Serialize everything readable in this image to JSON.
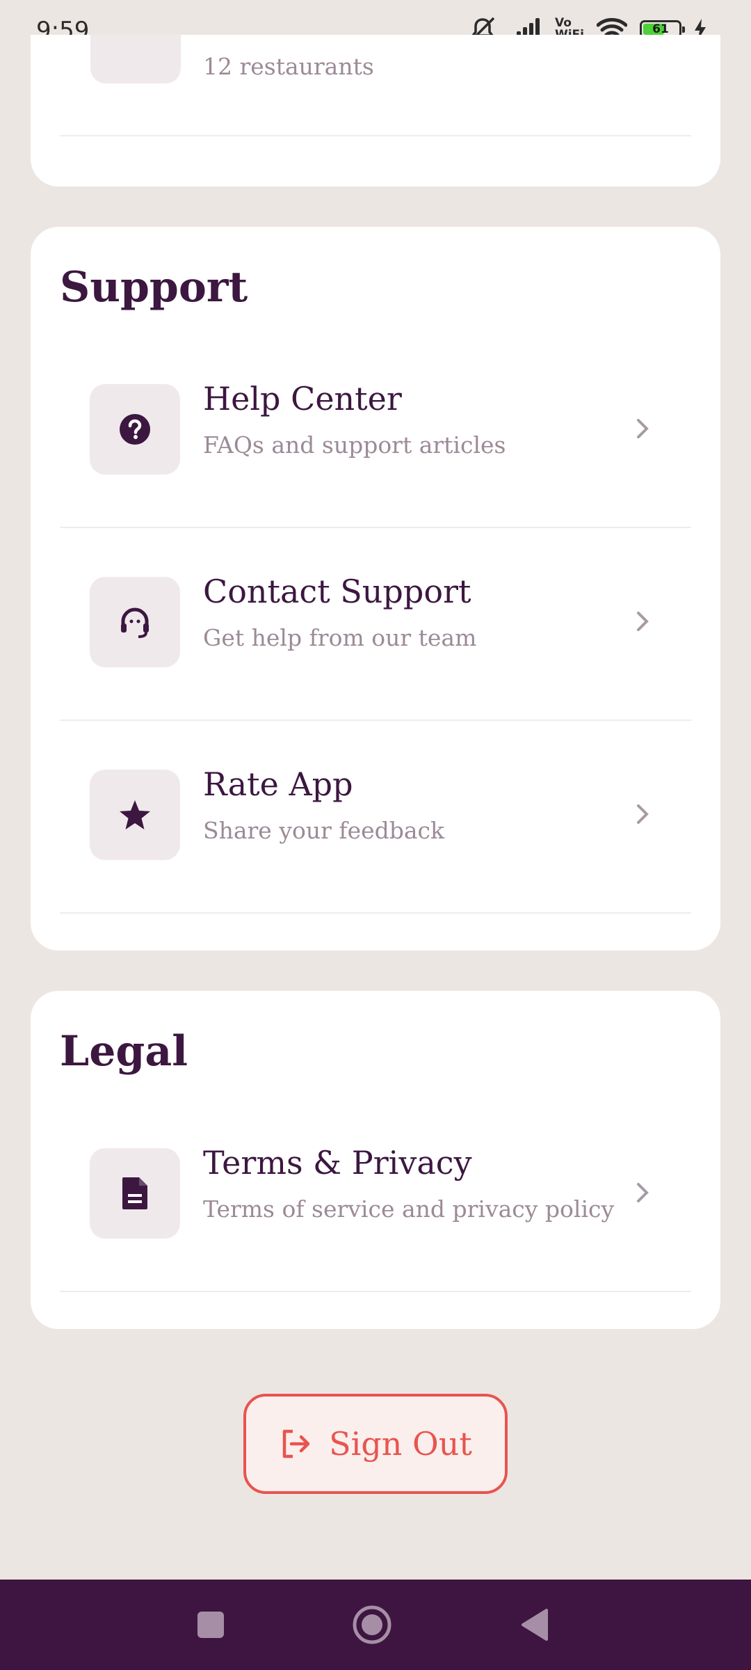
{
  "status_bar": {
    "time": "9:59",
    "vowifi_top": "Vo",
    "vowifi_bottom": "WiFi",
    "battery": "61"
  },
  "top_section": {
    "partial_subtitle": "12 restaurants"
  },
  "support": {
    "title": "Support",
    "items": [
      {
        "title": "Help Center",
        "subtitle": "FAQs and support articles",
        "icon": "help-circle-icon"
      },
      {
        "title": "Contact Support",
        "subtitle": "Get help from our team",
        "icon": "headset-icon"
      },
      {
        "title": "Rate App",
        "subtitle": "Share your feedback",
        "icon": "star-icon"
      }
    ]
  },
  "legal": {
    "title": "Legal",
    "items": [
      {
        "title": "Terms & Privacy",
        "subtitle": "Terms of service and privacy policy",
        "icon": "document-icon"
      }
    ]
  },
  "signout": {
    "label": "Sign Out",
    "icon": "logout-icon"
  },
  "colors": {
    "primary": "#3c1740",
    "danger": "#e8544f",
    "background": "#ece6e3",
    "tile": "#efe9ec",
    "muted": "#9c8a97"
  }
}
